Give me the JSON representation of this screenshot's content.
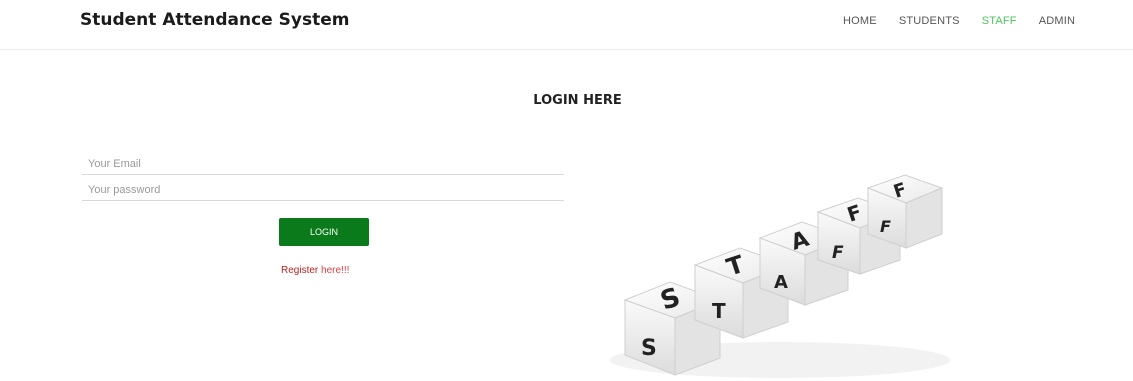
{
  "header": {
    "title": "Student Attendance System"
  },
  "nav": {
    "items": [
      {
        "label": "HOME"
      },
      {
        "label": "STUDENTS"
      },
      {
        "label": "STAFF",
        "active": true
      },
      {
        "label": "ADMIN"
      }
    ],
    "active_color": "#4cc65a"
  },
  "login": {
    "heading": "LOGIN HERE",
    "email_placeholder": "Your Email",
    "password_placeholder": "Your password",
    "button_label": "LOGIN",
    "button_color": "#0a7a1a",
    "register_part1": "Register",
    "register_part2": " here!!!"
  },
  "image": {
    "top_letters": [
      "S",
      "T",
      "A",
      "F",
      "F"
    ],
    "bottom_letters": [
      "S",
      "T",
      "A",
      "F",
      "F"
    ]
  }
}
